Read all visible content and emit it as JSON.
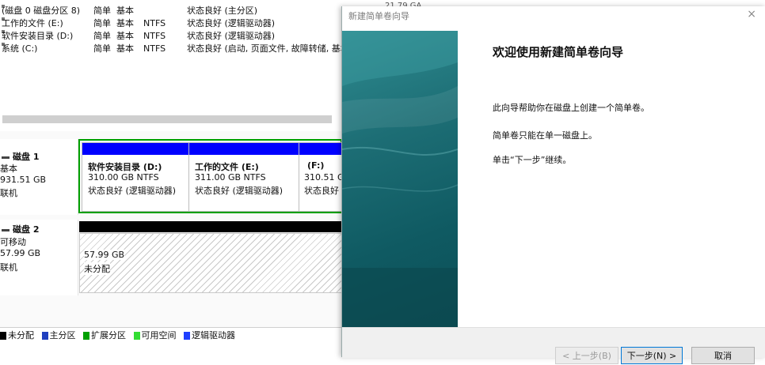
{
  "volumes": [
    {
      "name": "(磁盘 0 磁盘分区 8)",
      "layout": "简单",
      "type": "基本",
      "fs": "",
      "status": "状态良好 (主分区)",
      "extra": "21.79 GA"
    },
    {
      "name": "工作的文件 (E:)",
      "layout": "简单",
      "type": "基本",
      "fs": "NTFS",
      "status": "状态良好 (逻辑驱动器)",
      "extra": ""
    },
    {
      "name": "软件安装目录 (D:)",
      "layout": "简单",
      "type": "基本",
      "fs": "NTFS",
      "status": "状态良好 (逻辑驱动器)",
      "extra": ""
    },
    {
      "name": "系统 (C:)",
      "layout": "简单",
      "type": "基本",
      "fs": "NTFS",
      "status": "状态良好 (启动, 页面文件, 故障转储, 基本",
      "extra": ""
    }
  ],
  "disk1": {
    "title": "磁盘 1",
    "type": "基本",
    "size": "931.51 GB",
    "state": "联机",
    "partitions": [
      {
        "name": "软件安装目录  (D:)",
        "size": "310.00 GB NTFS",
        "status": "状态良好 (逻辑驱动器)"
      },
      {
        "name": "工作的文件  (E:)",
        "size": "311.00 GB NTFS",
        "status": "状态良好 (逻辑驱动器)"
      },
      {
        "name": "(F:)",
        "size": "310.51 G",
        "status": "状态良好"
      }
    ]
  },
  "disk2": {
    "title": "磁盘 2",
    "type": "可移动",
    "size": "57.99 GB",
    "state": "联机",
    "unallocated": {
      "size": "57.99 GB",
      "label": "未分配"
    }
  },
  "legend": [
    {
      "label": "未分配",
      "color": "#000000"
    },
    {
      "label": "主分区",
      "color": "#1f3fbf"
    },
    {
      "label": "扩展分区",
      "color": "#00a000"
    },
    {
      "label": "可用空间",
      "color": "#33dd33"
    },
    {
      "label": "逻辑驱动器",
      "color": "#1f3fff"
    }
  ],
  "wizard": {
    "title": "新建简单卷向导",
    "close": "×",
    "heading": "欢迎使用新建简单卷向导",
    "line1": "此向导帮助你在磁盘上创建一个简单卷。",
    "line2": "简单卷只能在单一磁盘上。",
    "line3": "单击“下一步”继续。",
    "back_label": "< 上一步(B)",
    "next_label": "下一步(N) >",
    "cancel_label": "取消"
  },
  "colors": {
    "logical": "#0000ff",
    "unallocated_bar": "#000000",
    "extended_border": "#00a000",
    "accent": "#0078d7"
  }
}
